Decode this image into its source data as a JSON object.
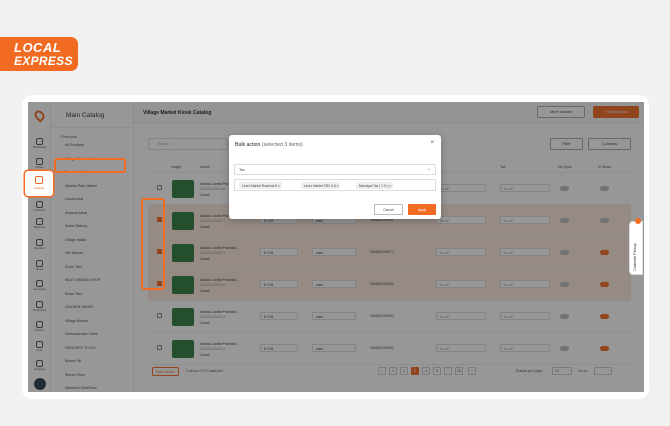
{
  "logo": {
    "line1": "LOCAL",
    "line2": "EXPRESS"
  },
  "rail": {
    "items": [
      "Dashboard",
      "Orders",
      "Catalog",
      "Customers",
      "Marketing",
      "Operators",
      "Shops",
      "Accounting",
      "Promotions",
      "Reports",
      "Apps",
      "Company"
    ],
    "active": "Catalog"
  },
  "panel": {
    "title": "Main Catalog",
    "section": "Products",
    "items": [
      "All Products",
      "Village Market Kiosk",
      "Breadside Kids",
      "Atlantis Park Market",
      "LiquorLand",
      "Avianna Meat",
      "Sweet Bakery",
      "Village Italian",
      "OM Market",
      "Ecom Test",
      "MULTI BRAND SHOP",
      "Ecom Test",
      "GOLDEN HANDS",
      "Village Market",
      "Demonstration Store",
      "GROCERY TO GO",
      "Bonne Vill",
      "Stores Store",
      "Sandwich TestStore"
    ]
  },
  "header": {
    "title": "Village Market Kiosk Catalog",
    "more_actions": "More actions",
    "add_product": "+ Add product"
  },
  "toolbar": {
    "search_placeholder": "Search",
    "filter": "Filter",
    "columns": "Columns"
  },
  "table": {
    "headers": [
      "Image",
      "Name",
      "Price",
      "Unit",
      "Barcode",
      "Tax",
      "Tax",
      "No Sync",
      "In Stock"
    ],
    "rows": [
      {
        "name": "Activia Lowfat Probiotic...",
        "sku": "0064632006410",
        "unit_label": "Count",
        "price": "$ 2.99",
        "unit": "each",
        "barcode": "0006632006410",
        "tax1": "No set",
        "tax2": "No set",
        "selected": false,
        "in_stock": false
      },
      {
        "name": "Activia Lowfat Probiotic...",
        "sku": "0064632006411",
        "unit_label": "Count",
        "price": "$ 2.99",
        "unit": "each",
        "barcode": "0006632006411",
        "tax1": "No set",
        "tax2": "No set",
        "selected": true,
        "in_stock": false
      },
      {
        "name": "Activia Lowfat Probiotic...",
        "sku": "0064632006071",
        "unit_label": "Count",
        "price": "$ 2.99",
        "unit": "each",
        "barcode": "0006632006071",
        "tax1": "No set",
        "tax2": "No set",
        "selected": true,
        "in_stock": true
      },
      {
        "name": "Activia Lowfat Probiotic...",
        "sku": "0064632006040",
        "unit_label": "Count",
        "price": "$ 2.99",
        "unit": "each",
        "barcode": "0006632006040",
        "tax1": "No set",
        "tax2": "No set",
        "selected": true,
        "in_stock": true
      },
      {
        "name": "Activia Lowfat Probiotic...",
        "sku": "0064632006033",
        "unit_label": "Count",
        "price": "$ 2.99",
        "unit": "each",
        "barcode": "0006632006033",
        "tax1": "No set",
        "tax2": "No set",
        "selected": false,
        "in_stock": true
      },
      {
        "name": "Activia Lowfat Probiotic...",
        "sku": "0064632006002",
        "unit_label": "Count",
        "price": "$ 2.99",
        "unit": "each",
        "barcode": "0006632006002",
        "tax1": "No set",
        "tax2": "No set",
        "selected": false,
        "in_stock": true
      }
    ]
  },
  "footer": {
    "bulk_action": "Bulk action",
    "selection": "3 items of 274 selected",
    "pages": [
      "1",
      "2",
      "3",
      "4",
      "5",
      "...",
      "28"
    ],
    "current_page": "3",
    "per_page_label": "Entries per page",
    "per_page": "10",
    "goto_label": "Go to:"
  },
  "modal": {
    "title": "Bulk action",
    "count": "(selected 3 items)",
    "field": "Tax",
    "tags": [
      "Lina's Market Road tax 8",
      "Lina's Market CRV 0.6",
      "Municipal Tax ( 1 % )"
    ],
    "cancel": "Cancel",
    "apply": "Apply"
  },
  "curbside": {
    "label": "Curbside Pickup"
  },
  "colors": {
    "accent": "#f26b23"
  }
}
